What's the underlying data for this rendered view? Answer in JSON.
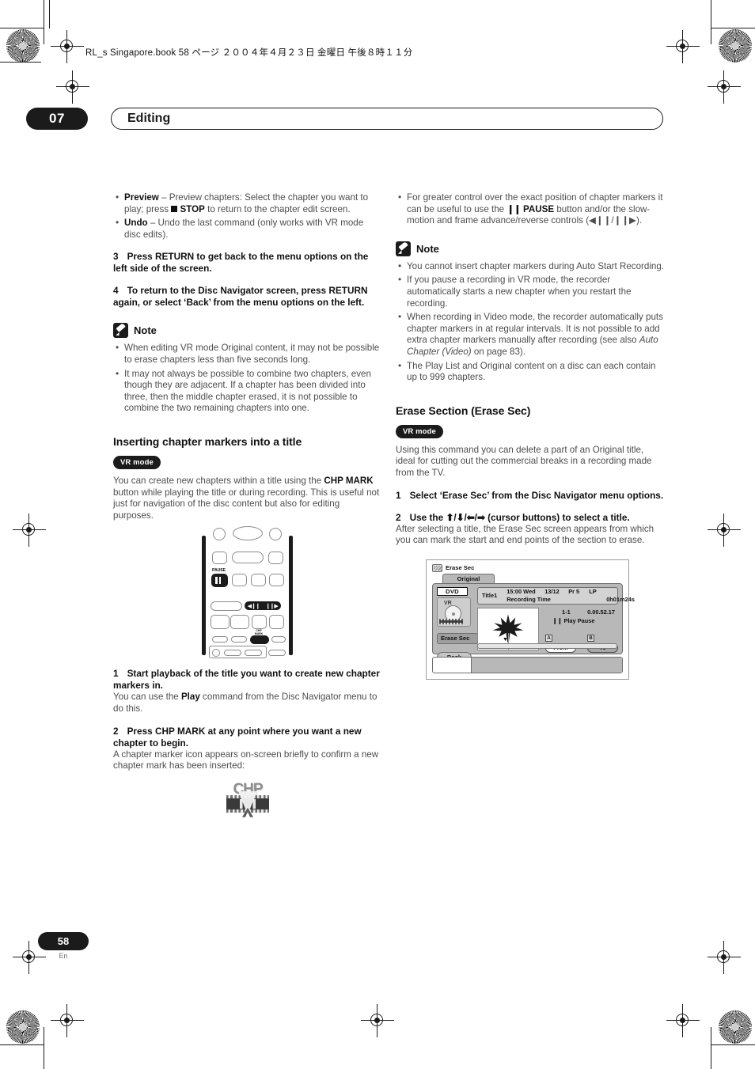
{
  "header": {
    "book_line": "RL_s Singapore.book 58 ページ ２００４年４月２３日 金曜日 午後８時１１分",
    "chapter_number": "07",
    "chapter_title": "Editing"
  },
  "footer": {
    "page_number": "58",
    "language": "En"
  },
  "left_column": {
    "bullets": [
      {
        "bold": "Preview",
        "text_before_stop": " – Preview chapters: Select the chapter you want to play; press ",
        "stop_bold": "STOP",
        "text_after_stop": " to return to the chapter edit screen."
      },
      {
        "bold": "Undo",
        "text": " – Undo the last command (only works with VR mode disc edits)."
      }
    ],
    "step3": {
      "num": "3",
      "text": "Press RETURN to get back to the menu options on the left side of the screen."
    },
    "step4": {
      "num": "4",
      "text": "To return to the Disc Navigator screen, press RETURN again, or select ‘Back’ from the menu options on the left."
    },
    "note": {
      "label": "Note",
      "items": [
        "When editing VR mode Original content, it may not be possible to erase chapters less than five seconds long.",
        "It may not always be possible to combine two chapters, even though they are adjacent. If a chapter has been divided into three, then the middle chapter erased, it is not possible to combine the two remaining chapters into one."
      ]
    },
    "section": {
      "heading": "Inserting chapter markers into a title",
      "mode_badge": "VR mode",
      "intro_part1": "You can create new chapters within a title using the ",
      "intro_bold1": "CHP MARK",
      "intro_part2": " button while playing the title or during recording. This is useful not just for navigation of the disc content but also for editing purposes."
    },
    "remote": {
      "pause_label": "PAUSE",
      "chp_label_line1": "CHP",
      "chp_label_line2": "MARK",
      "frame_rev": "◀❙❙",
      "frame_fwd": "❙❙▶"
    },
    "step1": {
      "num": "1",
      "text": "Start playback of the title you want to create new chapter markers in.",
      "body_part1": "You can use the ",
      "body_bold": "Play",
      "body_part2": " command from the Disc Navigator menu to do this."
    },
    "step2": {
      "num": "2",
      "text": "Press CHP MARK at any point where you want a new chapter to begin.",
      "body": "A chapter marker icon appears on-screen briefly to confirm a new chapter mark has been inserted:"
    },
    "chp_icon_text": "CHP"
  },
  "right_column": {
    "bullet_top": {
      "part1": "For greater control over the exact position of chapter markers it can be useful to use the ",
      "bold": "PAUSE",
      "part2": " button and/or the slow-motion and frame advance/reverse controls (◀❙❙/❙❙▶)."
    },
    "note": {
      "label": "Note",
      "items": [
        "You cannot insert chapter markers during Auto Start Recording.",
        "If you pause a recording in VR mode, the recorder automatically starts a new chapter when you restart the recording.",
        "When recording in Video mode, the recorder automatically puts chapter markers in at regular intervals. It is not possible to add extra chapter markers manually after recording (see also ",
        "The Play List and Original content on a disc can each contain up to 999 chapters."
      ],
      "item3_italic": "Auto Chapter (Video)",
      "item3_tail": " on page 83)."
    },
    "section": {
      "heading": "Erase Section (Erase Sec)",
      "mode_badge": "VR mode",
      "intro": "Using this command you can delete a part of an Original title, ideal for cutting out the commercial breaks in a recording made from the TV."
    },
    "step1": {
      "num": "1",
      "text": "Select ‘Erase Sec’ from the Disc Navigator menu options."
    },
    "step2": {
      "num": "2",
      "text_part1": "Use the ",
      "cursors": "⬆/⬇/⬅/➡",
      "text_part2": " (cursor buttons) to select a title.",
      "body": "After selecting a title, the Erase Sec screen appears from which you can mark the start and end points of the section to erase."
    },
    "osd": {
      "title": "Erase Sec",
      "tab": "Original",
      "disc_badge": "DVD",
      "disc_mode": "VR",
      "menu_item": "Erase Sec",
      "back_item": "Back",
      "info_title_label": "Title",
      "info_title_number": "1",
      "info_time": "15:00 Wed",
      "info_date": "13/12",
      "info_program": "Pr 5",
      "info_quality": "LP",
      "info_rec_label": "Recording Time",
      "info_rec_value": "0h01m24s",
      "chapter_ref": "1-1",
      "timecode": "0.00.52.17",
      "play_state": "❙❙ Play Pause",
      "tag_a": "A",
      "tag_b": "B",
      "btn_from": "From",
      "btn_to": "To",
      "marker": "▼"
    }
  }
}
